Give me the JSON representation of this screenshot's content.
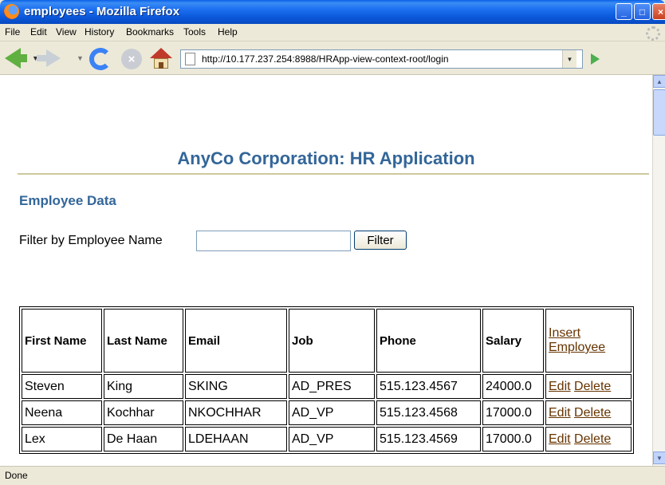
{
  "window": {
    "title": "employees - Mozilla Firefox"
  },
  "menu": [
    "File",
    "Edit",
    "View",
    "History",
    "Bookmarks",
    "Tools",
    "Help"
  ],
  "toolbar": {
    "url": "http://10.177.237.254:8988/HRApp-view-context-root/login"
  },
  "page": {
    "company_title": "AnyCo Corporation: HR Application",
    "section_heading": "Employee Data",
    "filter_label": "Filter by Employee Name",
    "filter_value": "",
    "filter_button": "Filter"
  },
  "table": {
    "headers": [
      "First Name",
      "Last Name",
      "Email",
      "Job",
      "Phone",
      "Salary"
    ],
    "insert_label": "Insert Employee",
    "edit_label": "Edit",
    "delete_label": "Delete",
    "rows": [
      [
        "Steven",
        "King",
        "SKING",
        "AD_PRES",
        "515.123.4567",
        "24000.0"
      ],
      [
        "Neena",
        "Kochhar",
        "NKOCHHAR",
        "AD_VP",
        "515.123.4568",
        "17000.0"
      ],
      [
        "Lex",
        "De Haan",
        "LDEHAAN",
        "AD_VP",
        "515.123.4569",
        "17000.0"
      ]
    ]
  },
  "status": {
    "text": "Done"
  },
  "icons": [
    "firefox-icon",
    "back-icon",
    "forward-icon",
    "reload-icon",
    "stop-icon",
    "home-icon",
    "page-icon",
    "go-icon"
  ]
}
